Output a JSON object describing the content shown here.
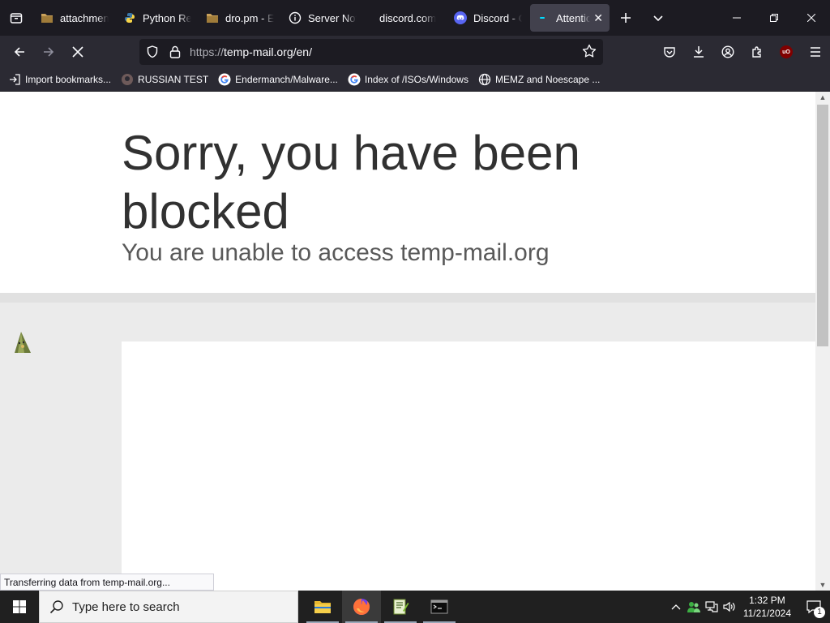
{
  "tabs": [
    {
      "title": "attachments",
      "favicon": "folder-icon",
      "active": false
    },
    {
      "title": "Python Releases",
      "favicon": "python-icon",
      "active": false
    },
    {
      "title": "dro.pm - E",
      "favicon": "folder-icon",
      "active": false
    },
    {
      "title": "Server Not",
      "favicon": "info-icon",
      "active": false
    },
    {
      "title": "discord.com",
      "favicon": "",
      "active": false
    },
    {
      "title": "Discord - C",
      "favicon": "discord-icon",
      "active": false
    },
    {
      "title": "Attention",
      "favicon": "loading-icon",
      "active": true
    }
  ],
  "navbar": {
    "url_protocol": "https://",
    "url_host": "temp-mail.org/en/"
  },
  "bookmarks": [
    {
      "label": "Import bookmarks...",
      "icon": "import-icon"
    },
    {
      "label": "RUSSIAN TEST",
      "icon": "github-icon"
    },
    {
      "label": "Endermanch/Malware...",
      "icon": "google-icon"
    },
    {
      "label": "Index of /ISOs/Windows",
      "icon": "google-icon"
    },
    {
      "label": "MEMZ and Noescape ...",
      "icon": "globe-icon"
    }
  ],
  "page": {
    "title": "Sorry, you have been blocked",
    "subtitle": "You are unable to access temp-mail.org"
  },
  "status_text": "Transferring data from temp-mail.org...",
  "taskbar": {
    "search_placeholder": "Type here to search",
    "time": "1:32 PM",
    "date": "11/21/2024",
    "notification_count": "1"
  },
  "colors": {
    "tab_bg": "#1c1b22",
    "toolbar_bg": "#2b2a33",
    "active_tab": "#42414d",
    "title_text": "#313131"
  }
}
